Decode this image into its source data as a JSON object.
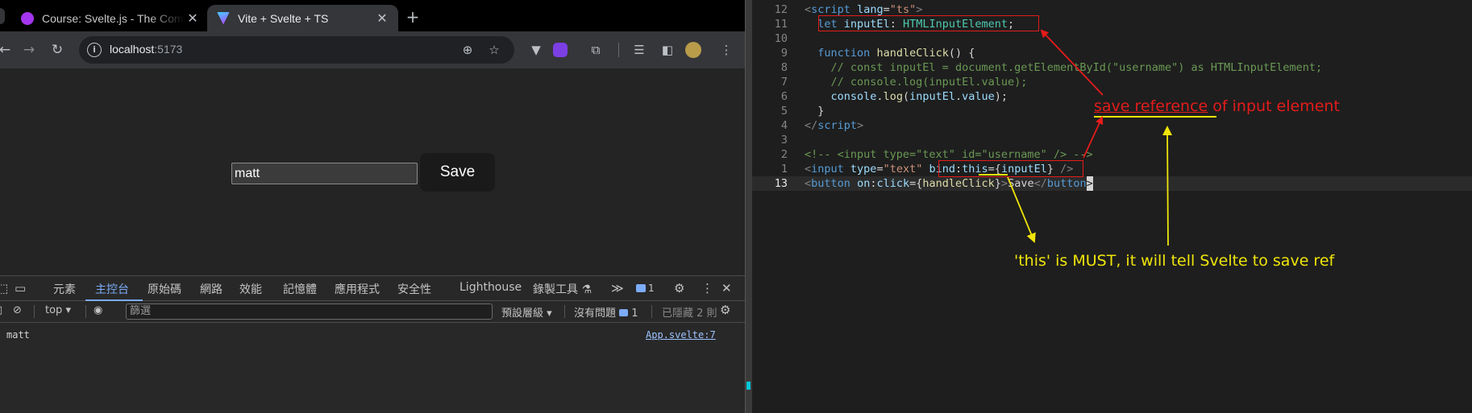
{
  "browser": {
    "tabs": [
      {
        "title": "Course: Svelte.js - The Complete Guide",
        "favicon": "udemy-icon",
        "active": false
      },
      {
        "title": "Vite + Svelte + TS",
        "favicon": "vite-icon",
        "active": true
      }
    ],
    "close_glyph": "✕",
    "new_tab_glyph": "+",
    "url_host": "localhost",
    "url_port": ":5173",
    "page": {
      "input_value": "matt",
      "save_label": "Save"
    }
  },
  "devtools": {
    "tabs": [
      "元素",
      "主控台",
      "原始碼",
      "網路",
      "效能",
      "記憶體",
      "應用程式",
      "安全性",
      "Lighthouse",
      "錄製工具 ⚗"
    ],
    "active_tab": "主控台",
    "more_glyph": "≫",
    "issues_count": "1",
    "context": "top",
    "filter_placeholder": "篩選",
    "levels": "預設層級",
    "no_issues": "沒有問題",
    "no_issues_count": "1",
    "hidden": "已隱藏 2 則",
    "log": {
      "text": "matt",
      "source": "App.svelte:7"
    }
  },
  "editor": {
    "lines": [
      {
        "n": "12",
        "html": "<span class=\"t-tag\">&lt;</span><span class=\"t-tname\">script</span> <span class=\"t-attr\">lang</span><span class=\"t-punct\">=</span><span class=\"t-str\">\"ts\"</span><span class=\"t-tag\">&gt;</span>"
      },
      {
        "n": "11",
        "html": "  <span class=\"t-key\">let</span> <span class=\"t-var\">inputEl</span><span class=\"t-punct\">: </span><span class=\"t-type\">HTMLInputElement</span><span class=\"t-punct\">;</span>"
      },
      {
        "n": "10",
        "html": ""
      },
      {
        "n": "9",
        "html": "  <span class=\"t-key\">function</span> <span class=\"t-fn\">handleClick</span><span class=\"t-punct\">() {</span>"
      },
      {
        "n": "8",
        "html": "    <span class=\"t-cm\">// const inputEl = document.getElementById(\"username\") as HTMLInputElement;</span>"
      },
      {
        "n": "7",
        "html": "    <span class=\"t-cm\">// console.log(inputEl.value);</span>"
      },
      {
        "n": "6",
        "html": "    <span class=\"t-var\">console</span><span class=\"t-punct\">.</span><span class=\"t-fn\">log</span><span class=\"t-punct\">(</span><span class=\"t-var\">inputEl</span><span class=\"t-punct\">.</span><span class=\"t-var\">value</span><span class=\"t-punct\">);</span>"
      },
      {
        "n": "5",
        "html": "  <span class=\"t-punct\">}</span>"
      },
      {
        "n": "4",
        "html": "<span class=\"t-tag\">&lt;/</span><span class=\"t-tname\">script</span><span class=\"t-tag\">&gt;</span>"
      },
      {
        "n": "3",
        "html": ""
      },
      {
        "n": "2",
        "html": "<span class=\"t-cm\">&lt;!-- &lt;input type=\"text\" id=\"username\" /&gt; --&gt;</span>"
      },
      {
        "n": "1",
        "html": "<span class=\"t-tag\">&lt;</span><span class=\"t-tname\">input</span> <span class=\"t-attr\">type</span><span class=\"t-punct\">=</span><span class=\"t-str\">\"text\"</span> <span class=\"t-attr\">bind</span><span class=\"t-punct\">:</span><span class=\"t-attr\">this</span><span class=\"t-punct\">={</span><span class=\"t-var\">inputEl</span><span class=\"t-punct\">}</span> <span class=\"t-tag\">/&gt;</span>"
      },
      {
        "n": "13",
        "html": "<span class=\"t-tag\">&lt;</span><span class=\"t-tname\">button</span> <span class=\"t-attr\">on</span><span class=\"t-punct\">:</span><span class=\"t-attr\">click</span><span class=\"t-punct\">={</span><span class=\"t-fn\">handleClick</span><span class=\"t-punct\">}</span><span class=\"t-tag\">&gt;</span><span class=\"t-punct\">Save</span><span class=\"t-tag\">&lt;/</span><span class=\"t-tname\">button</span><span class=\"cursor t-tag\">&gt;</span>"
      }
    ],
    "current_line": "13"
  },
  "annotations": {
    "red_underlined": "save reference",
    "red_rest": " of input element",
    "yellow": "'this' is MUST, it will tell Svelte to save ref",
    "red_color": "#e51b1b",
    "yellow_color": "#f0e50a"
  }
}
